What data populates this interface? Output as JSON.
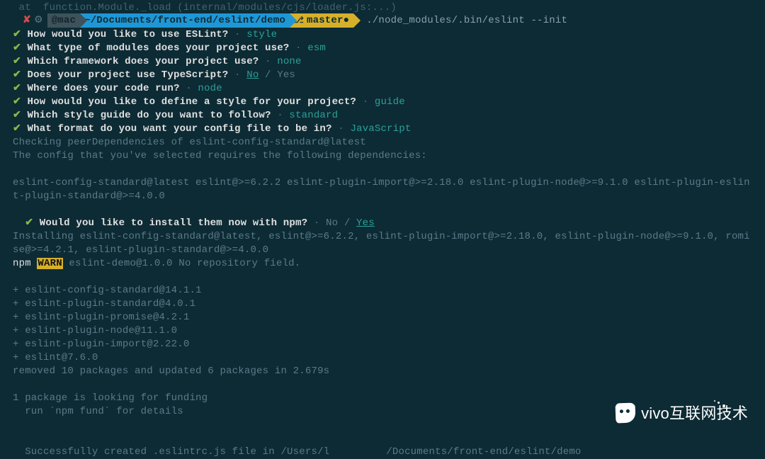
{
  "top_cut_line": " at  function.Module._load (internal/modules/cjs/loader.js:...) ",
  "topbar": {
    "user": "   @mac ",
    "path": " ~/Documents/front-end/eslint/demo ",
    "branch_icon": "⎇",
    "branch": "master ",
    "branch_dirty": "●",
    "command": "./node_modules/.bin/eslint --init"
  },
  "qa": [
    {
      "q": "How would you like to use ESLint?",
      "a": "style"
    },
    {
      "q": "What type of modules does your project use?",
      "a": "esm"
    },
    {
      "q": "Which framework does your project use?",
      "a": "none"
    },
    {
      "q": "Does your project use TypeScript?",
      "a_raw": true
    },
    {
      "q": "Where does your code run?",
      "a": "node"
    },
    {
      "q": "How would you like to define a style for your project?",
      "a": "guide"
    },
    {
      "q": "Which style guide do you want to follow?",
      "a": "standard"
    },
    {
      "q": "What format do you want your config file to be in?",
      "a": "JavaScript"
    }
  ],
  "ts_no": "No",
  "ts_sep": " / ",
  "ts_yes": "Yes",
  "line_check_peer": "Checking peerDependencies of eslint-config-standard@latest",
  "line_config_req": "The config that you've selected requires the following dependencies:",
  "line_deps": "eslint-config-standard@latest eslint@>=6.2.2 eslint-plugin-import@>=2.18.0 eslint-plugin-node@>=9.1.0 eslint-plugin-eslint-plugin-standard@>=4.0.0",
  "install_q": "Would you like to install them now with npm?",
  "install_no": "No",
  "install_sep": " / ",
  "install_yes": "Yes",
  "line_installing": "Installing eslint-config-standard@latest, eslint@>=6.2.2, eslint-plugin-import@>=2.18.0, eslint-plugin-node@>=9.1.0, romise@>=4.2.1, eslint-plugin-standard@>=4.0.0",
  "npm_label": "npm",
  "warn_label": "WARN",
  "npm_warn": " eslint-demo@1.0.0 No repository field.",
  "plus_lines": [
    "+ eslint-config-standard@14.1.1",
    "+ eslint-plugin-standard@4.0.1",
    "+ eslint-plugin-promise@4.2.1",
    "+ eslint-plugin-node@11.1.0",
    "+ eslint-plugin-import@2.22.0",
    "+ eslint@7.6.0"
  ],
  "line_removed": "removed 10 packages and updated 6 packages in 2.679s",
  "line_funding1": "1 package is looking for funding",
  "line_funding2": "  run `npm fund` for details",
  "line_success_a": "Successfully created .eslintrc.js file in /Users/l",
  "line_success_b": "/Documents/front-end/eslint/demo",
  "watermark": "vivo互联网技术",
  "dot": "·"
}
